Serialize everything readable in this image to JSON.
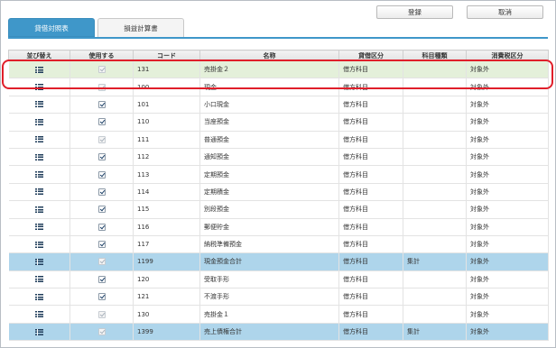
{
  "tabs": [
    {
      "label": "貸借対照表",
      "active": true
    },
    {
      "label": "損益計算書",
      "active": false
    }
  ],
  "buttons": {
    "register": "登録",
    "cancel": "取消"
  },
  "table": {
    "headers": [
      "並び替え",
      "使用する",
      "コード",
      "名称",
      "貸借区分",
      "科目種類",
      "消費税区分"
    ],
    "rows": [
      {
        "checked": true,
        "disabled": true,
        "code": "131",
        "name": "売掛金２",
        "side": "借方科目",
        "kind": "",
        "tax": "対象外",
        "style": "sel"
      },
      {
        "checked": true,
        "disabled": true,
        "code": "100",
        "name": "現金",
        "side": "借方科目",
        "kind": "",
        "tax": "対象外",
        "style": ""
      },
      {
        "checked": true,
        "disabled": false,
        "code": "101",
        "name": "小口現金",
        "side": "借方科目",
        "kind": "",
        "tax": "対象外",
        "style": ""
      },
      {
        "checked": true,
        "disabled": false,
        "code": "110",
        "name": "当座預金",
        "side": "借方科目",
        "kind": "",
        "tax": "対象外",
        "style": ""
      },
      {
        "checked": true,
        "disabled": true,
        "code": "111",
        "name": "普通預金",
        "side": "借方科目",
        "kind": "",
        "tax": "対象外",
        "style": ""
      },
      {
        "checked": true,
        "disabled": false,
        "code": "112",
        "name": "通知預金",
        "side": "借方科目",
        "kind": "",
        "tax": "対象外",
        "style": ""
      },
      {
        "checked": true,
        "disabled": false,
        "code": "113",
        "name": "定期預金",
        "side": "借方科目",
        "kind": "",
        "tax": "対象外",
        "style": ""
      },
      {
        "checked": true,
        "disabled": false,
        "code": "114",
        "name": "定期積金",
        "side": "借方科目",
        "kind": "",
        "tax": "対象外",
        "style": ""
      },
      {
        "checked": true,
        "disabled": false,
        "code": "115",
        "name": "別段預金",
        "side": "借方科目",
        "kind": "",
        "tax": "対象外",
        "style": ""
      },
      {
        "checked": true,
        "disabled": false,
        "code": "116",
        "name": "郵便貯金",
        "side": "借方科目",
        "kind": "",
        "tax": "対象外",
        "style": ""
      },
      {
        "checked": true,
        "disabled": false,
        "code": "117",
        "name": "納税準備預金",
        "side": "借方科目",
        "kind": "",
        "tax": "対象外",
        "style": ""
      },
      {
        "checked": true,
        "disabled": true,
        "code": "1199",
        "name": "現金預金合計",
        "side": "借方科目",
        "kind": "集計",
        "tax": "対象外",
        "style": "total"
      },
      {
        "checked": true,
        "disabled": false,
        "code": "120",
        "name": "受取手形",
        "side": "借方科目",
        "kind": "",
        "tax": "対象外",
        "style": ""
      },
      {
        "checked": true,
        "disabled": false,
        "code": "121",
        "name": "不渡手形",
        "side": "借方科目",
        "kind": "",
        "tax": "対象外",
        "style": ""
      },
      {
        "checked": true,
        "disabled": true,
        "code": "130",
        "name": "売掛金１",
        "side": "借方科目",
        "kind": "",
        "tax": "対象外",
        "style": ""
      },
      {
        "checked": true,
        "disabled": true,
        "code": "1399",
        "name": "売上債権合計",
        "side": "借方科目",
        "kind": "集計",
        "tax": "対象外",
        "style": "total"
      }
    ]
  },
  "colors": {
    "accent": "#3f97c9",
    "selected_row": "#e4f0da",
    "total_row": "#aed5eb",
    "highlight": "#e01f2a"
  }
}
